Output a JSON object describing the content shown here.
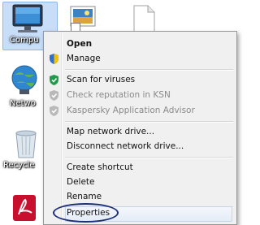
{
  "desktop": {
    "icons": [
      {
        "label": "Compu",
        "icon": "computer-icon"
      },
      {
        "label": "Netwo",
        "icon": "network-icon"
      },
      {
        "label": "Recycle",
        "icon": "recycle-bin-icon"
      },
      {
        "label": "",
        "icon": "pdf-reader-icon"
      },
      {
        "label": "",
        "icon": "photo-shortcut-icon"
      },
      {
        "label": "",
        "icon": "blank-document-icon"
      }
    ]
  },
  "context_menu": {
    "open": "Open",
    "manage": "Manage",
    "scan": "Scan for viruses",
    "check_reputation": "Check reputation in KSN",
    "kaspersky_advisor": "Kaspersky Application Advisor",
    "map_drive": "Map network drive...",
    "disconnect_drive": "Disconnect network drive...",
    "create_shortcut": "Create shortcut",
    "delete": "Delete",
    "rename": "Rename",
    "properties": "Properties"
  },
  "colors": {
    "highlight_oval": "#1a2e7a",
    "kaspersky_green": "#1f9b4a",
    "menu_background": "#f0f0f0"
  }
}
